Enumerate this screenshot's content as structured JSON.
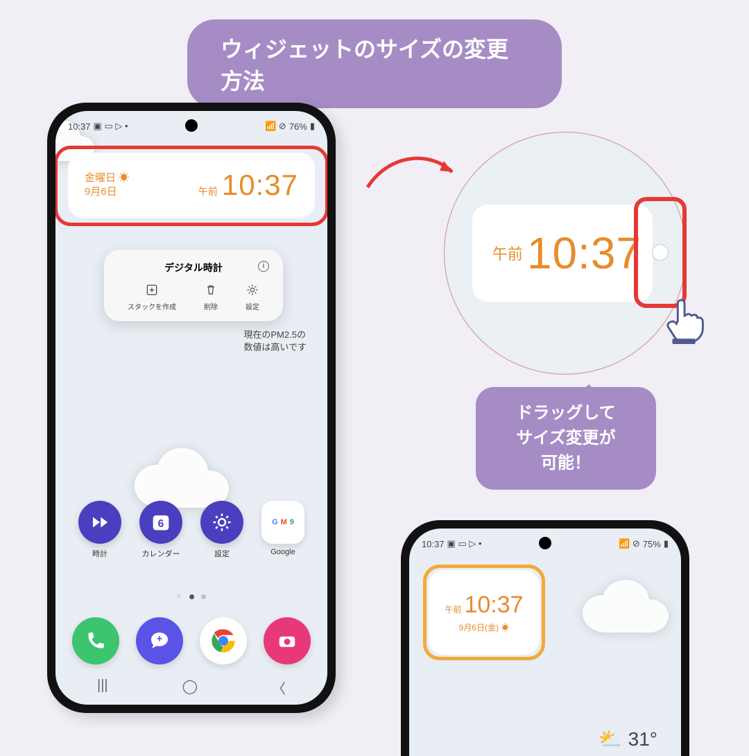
{
  "title": "ウィジェットのサイズの変更方法",
  "phone1": {
    "status": {
      "time": "10:37",
      "battery": "76%"
    },
    "widget": {
      "day": "金曜日 ☀",
      "date": "9月6日",
      "ampm": "午前",
      "time": "10:37"
    },
    "popup": {
      "title": "デジタル時計",
      "items": [
        {
          "label": "スタックを作成"
        },
        {
          "label": "削除"
        },
        {
          "label": "設定"
        }
      ]
    },
    "pm25": {
      "line1": "現在のPM2.5の",
      "line2": "数値は高いです"
    },
    "apps": [
      {
        "label": "時計"
      },
      {
        "label": "カレンダー",
        "day": "6"
      },
      {
        "label": "設定"
      },
      {
        "label": "Google"
      }
    ]
  },
  "zoom": {
    "ampm": "午前",
    "time": "10:37"
  },
  "bubble": {
    "l1": "ドラッグして",
    "l2": "サイズ変更が",
    "l3": "可能！"
  },
  "phone2": {
    "status": {
      "time": "10:37",
      "battery": "75%"
    },
    "widget": {
      "ampm": "午前",
      "time": "10:37",
      "date": "9月6日(金) ☀"
    },
    "temp": "31°"
  }
}
